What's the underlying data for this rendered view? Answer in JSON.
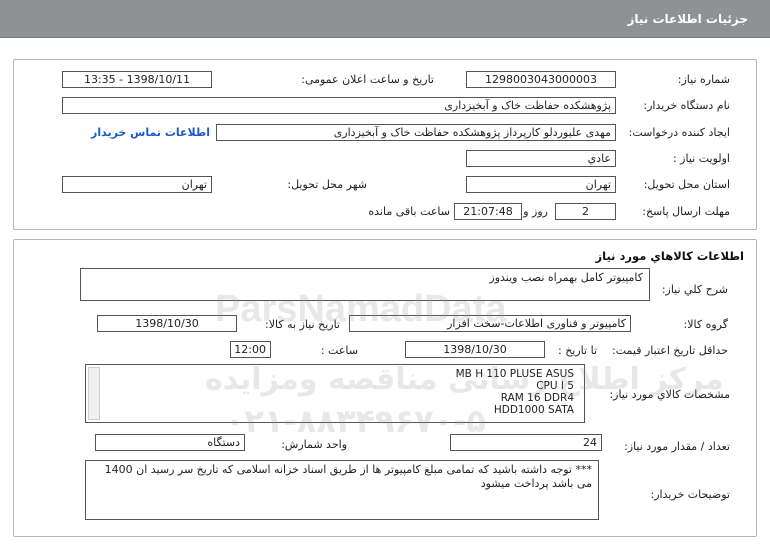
{
  "header": {
    "title": "جزئیات اطلاعات نیاز"
  },
  "need_info": {
    "need_number": {
      "label": "شماره نیاز:",
      "value": "1298003043000003"
    },
    "announce": {
      "label": "تاریخ و ساعت اعلان عمومی:",
      "value": "1398/10/11 - 13:35"
    },
    "buyer_org": {
      "label": "نام دستگاه خریدار:",
      "value": "پژوهشکده حفاظت خاک و آبخیزداری"
    },
    "creator": {
      "label": "ایجاد کننده درخواست:",
      "value": "مهدی علیوردلو کارپرداز پژوهشکده حفاظت خاک و آبخیزداری"
    },
    "contact_link": "اطلاعات تماس خریدار",
    "priority": {
      "label": "اولویت نیاز :",
      "value": "عادي"
    },
    "province": {
      "label": "استان محل تحویل:",
      "value": "تهران"
    },
    "city": {
      "label": "شهر محل تحویل:",
      "value": "تهران"
    },
    "deadline": {
      "label": "مهلت ارسال پاسخ:",
      "days": "2",
      "days_word": "روز و",
      "time": "21:07:48",
      "remaining": "ساعت باقی مانده"
    }
  },
  "goods": {
    "section_title": "اطلاعات کالاهاي مورد نياز",
    "general_desc": {
      "label": "شرح کلي نياز:",
      "value": "کامپیوتر کامل بهمراه نصب ویندوز"
    },
    "group": {
      "label": "گروه کالا:",
      "value": "کامپیوتر و فناوری اطلاعات-سخت افزار"
    },
    "need_date": {
      "label": "تاریخ نیاز به کالا:",
      "value": "1398/10/30"
    },
    "min_validity": {
      "label": "حداقل تاریخ اعتبار قیمت:",
      "until_label": "تا تاریخ :",
      "date": "1398/10/30",
      "time_label": "ساعت :",
      "time": "12:00"
    },
    "specs": {
      "label": "مشخصات کالاي مورد نياز:",
      "lines": [
        "MB H 110 PLUSE  ASUS",
        "CPU I 5",
        "RAM 16 DDR4",
        "HDD1000 SATA"
      ]
    },
    "quantity": {
      "label": "تعداد / مقدار مورد نیاز:",
      "value": "24"
    },
    "unit": {
      "label": "واحد شمارش:",
      "value": "دستگاه"
    },
    "buyer_notes": {
      "label": "توضیحات خریدار:",
      "value": "*** توجه داشته باشید که تمامی مبلغ کامپیوتر ها از طریق اسناد خزانه اسلامی که تاریخ سر رسید ان 1400 می باشد پرداخت میشود"
    }
  },
  "watermark": {
    "brand": "ParsNamadData",
    "line1": "مرکز اطلاع رسانی مناقصه ومزایده",
    "line2": "۰۲۱-۸۸۳۴۹۶۷۰-۵"
  }
}
